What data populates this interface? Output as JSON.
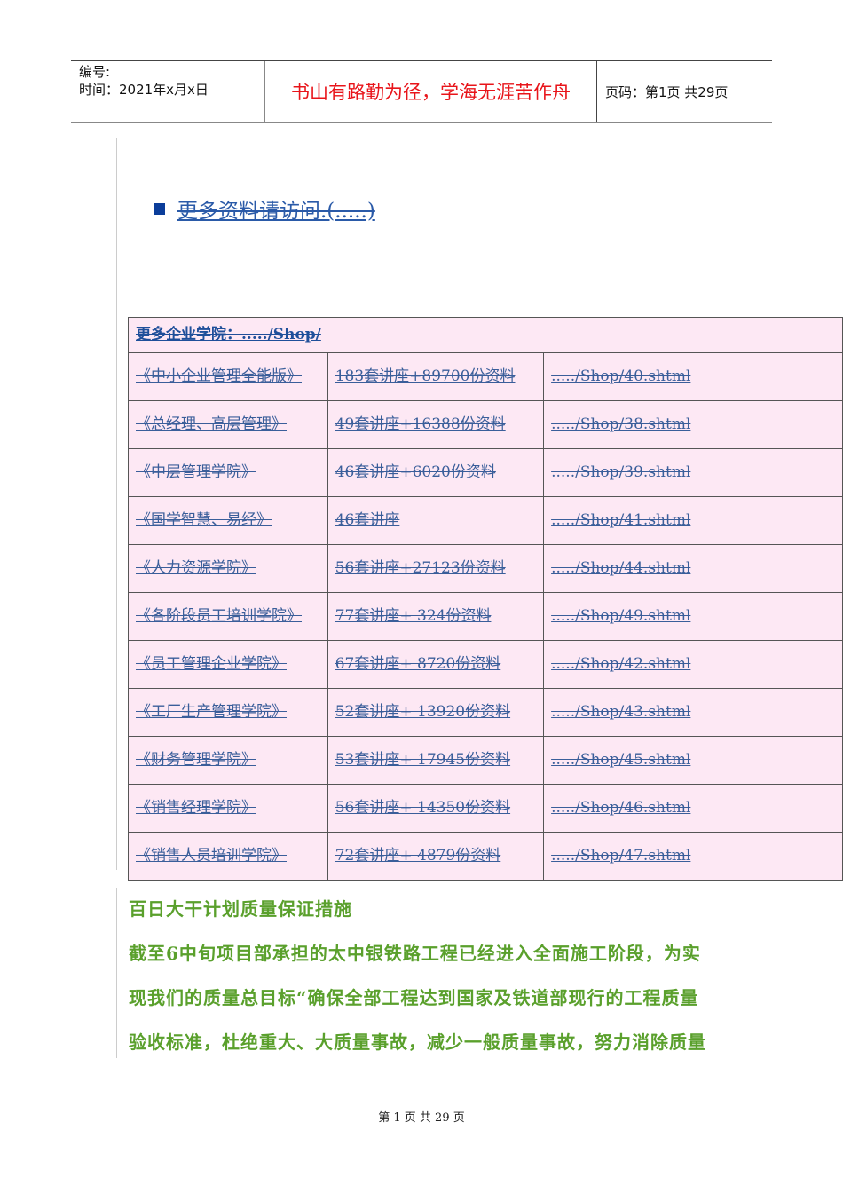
{
  "header": {
    "number_label": "编号:",
    "date_label": "时间：2021年x月x日",
    "motto": "书山有路勤为径，学海无涯苦作舟",
    "page_info": "页码：第1页  共29页"
  },
  "more_link": "更多资料请访问.(.....)",
  "table": {
    "title": "更多企业学院：...../Shop/",
    "rows": [
      [
        "《中小企业管理全能版》",
        "183套讲座+89700份资料",
        "...../Shop/40.shtml"
      ],
      [
        "《总经理、高层管理》",
        "49套讲座+16388份资料",
        "...../Shop/38.shtml"
      ],
      [
        "《中层管理学院》",
        "46套讲座+6020份资料",
        "...../Shop/39.shtml"
      ],
      [
        "《国学智慧、易经》",
        "46套讲座",
        "...../Shop/41.shtml"
      ],
      [
        "《人力资源学院》",
        "56套讲座+27123份资料",
        "...../Shop/44.shtml"
      ],
      [
        "《各阶段员工培训学院》",
        "77套讲座+ 324份资料",
        "...../Shop/49.shtml"
      ],
      [
        "《员工管理企业学院》",
        "67套讲座+ 8720份资料",
        "...../Shop/42.shtml"
      ],
      [
        "《工厂生产管理学院》",
        "52套讲座+ 13920份资料",
        "...../Shop/43.shtml"
      ],
      [
        "《财务管理学院》",
        "53套讲座+ 17945份资料",
        "...../Shop/45.shtml"
      ],
      [
        "《销售经理学院》",
        "56套讲座+ 14350份资料",
        "...../Shop/46.shtml"
      ],
      [
        "《销售人员培训学院》",
        "72套讲座+ 4879份资料",
        "...../Shop/47.shtml"
      ]
    ]
  },
  "body": {
    "heading": "百日大干计划质量保证措施",
    "lines": [
      "截至6中旬项目部承担的太中银铁路工程已经进入全面施工阶段，为实",
      "现我们的质量总目标“确保全部工程达到国家及铁道部现行的工程质量",
      "验收标准，杜绝重大、大质量事故，减少一般质量事故，努力消除质量"
    ]
  },
  "footer": "第 1 页 共 29 页"
}
